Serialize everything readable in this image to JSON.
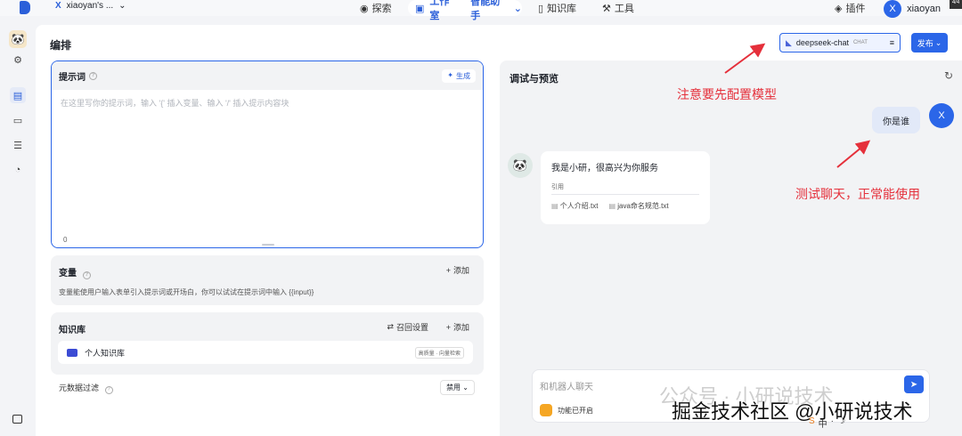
{
  "topbar": {
    "workspace": "xiaoyan's ...",
    "nav": {
      "explore": "探索",
      "workbench": "工作室",
      "assistant": "智能助手",
      "knowledge": "知识库",
      "tools": "工具"
    },
    "plugins": "插件",
    "user_name": "xiaoyan",
    "avatar_letter": "X",
    "corner_badge": "4/4"
  },
  "page": {
    "title": "编排"
  },
  "header_actions": {
    "model": "deepseek-chat",
    "model_tag": "CHAT",
    "publish": "发布"
  },
  "prompt": {
    "title": "提示词",
    "generate": "生成",
    "placeholder": "在这里写你的提示词，输入 '{' 插入变量、输入 '/' 插入提示内容块",
    "count": "0"
  },
  "variables": {
    "title": "变量",
    "add": "添加",
    "description": "变量能使用户输入表单引入提示词或开场白，你可以试试在提示词中输入 {{input}}"
  },
  "knowledge": {
    "title": "知识库",
    "recall": "召回设置",
    "add": "添加",
    "item": "个人知识库",
    "tag": "高质量 · 向量检索"
  },
  "metadata": {
    "label": "元数据过滤",
    "value": "禁用"
  },
  "preview": {
    "title": "调试与预览",
    "user_message": "你是谁",
    "user_avatar": "X",
    "bot_message": "我是小研，很高兴为你服务",
    "citation_label": "引用",
    "citations": [
      "个人介绍.txt",
      "java命名规范.txt"
    ],
    "input_placeholder": "和机器人聊天",
    "feature_status": "功能已开启"
  },
  "annotations": {
    "model_note": "注意要先配置模型",
    "chat_note": "测试聊天，正常能使用",
    "color": "#e5303b"
  },
  "watermark": {
    "line1": "公众号 · 小研说技术",
    "line2": "掘金技术社区 @小研说技术"
  },
  "tray": {
    "ime": "中",
    "dot": "·",
    "moon": "☽"
  }
}
